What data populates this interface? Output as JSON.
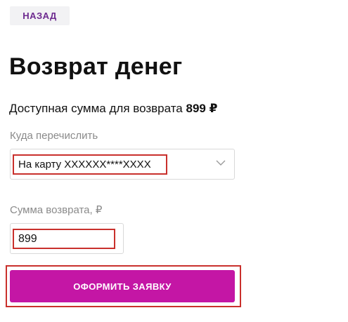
{
  "header": {
    "back_label": "НАЗАД"
  },
  "main": {
    "title": "Возврат денег",
    "available_text": "Доступная сумма для возврата",
    "available_amount": "899 ₽"
  },
  "form": {
    "destination_label": "Куда перечислить",
    "destination_value": "На карту XXXXXX****XXXX",
    "amount_label": "Сумма возврата, ₽",
    "amount_value": "899",
    "submit_label": "ОФОРМИТЬ ЗАЯВКУ"
  },
  "colors": {
    "accent": "#c416a5",
    "highlight": "#c9302c",
    "back_text": "#6d2a8f"
  },
  "icons": {
    "select_arrow": "chevron-down-icon"
  }
}
